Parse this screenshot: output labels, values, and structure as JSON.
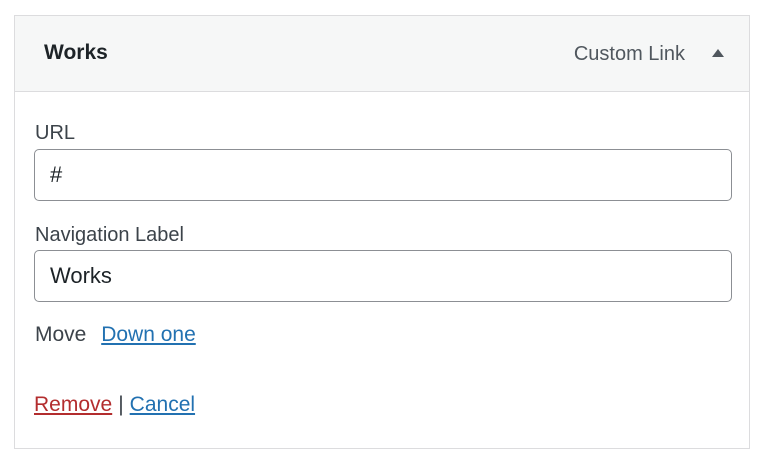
{
  "menu_item": {
    "title": "Works",
    "type_label": "Custom Link",
    "toggle_icon": "triangle-up-icon",
    "url": {
      "label": "URL",
      "value": "#"
    },
    "navigation_label": {
      "label": "Navigation Label",
      "value": "Works"
    },
    "move": {
      "label": "Move",
      "down_one": "Down one"
    },
    "actions": {
      "remove": "Remove",
      "separator": "|",
      "cancel": "Cancel"
    }
  },
  "colors": {
    "link_blue": "#2271b1",
    "link_red": "#b32d2e",
    "header_bg": "#f6f7f7",
    "border": "#dcdcde"
  }
}
